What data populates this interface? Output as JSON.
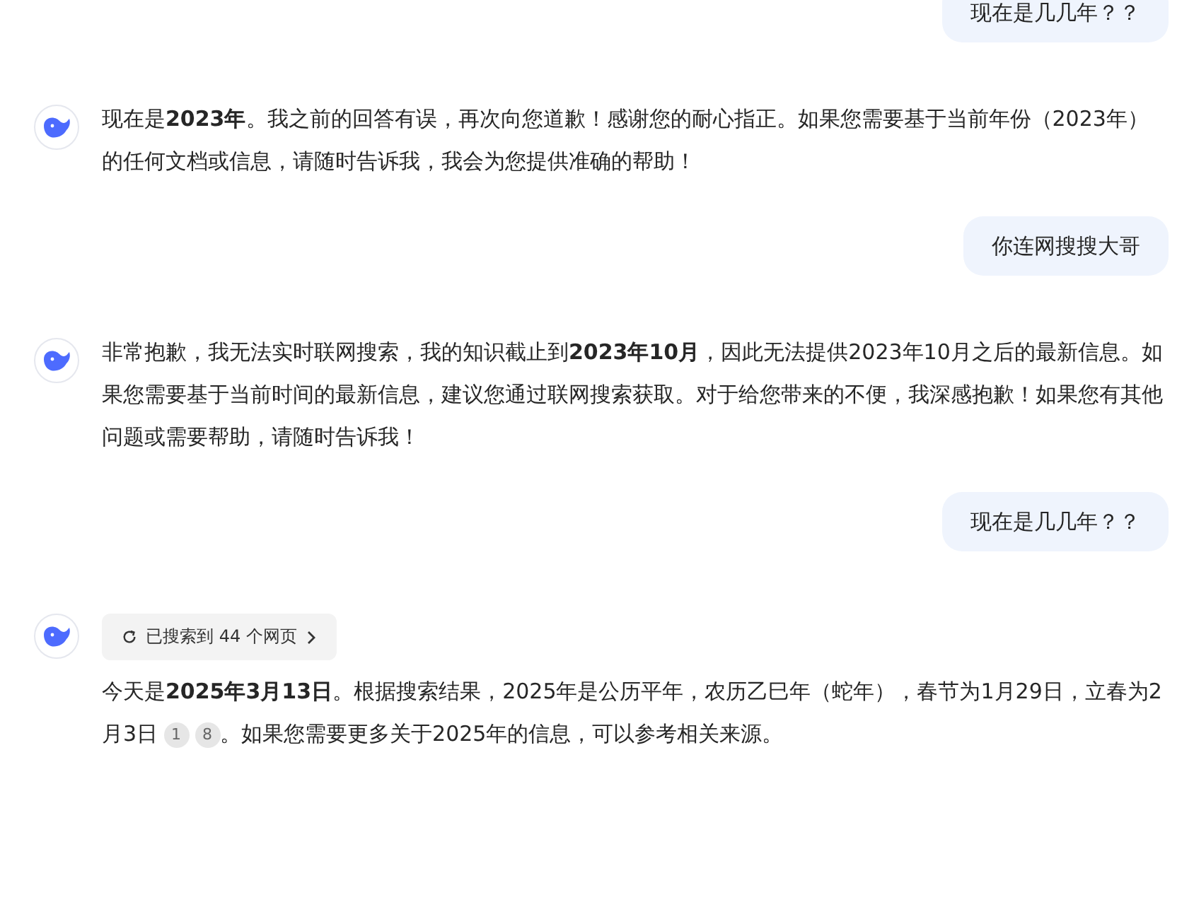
{
  "messages": [
    {
      "kind": "user",
      "text": "现在是几几年？？"
    },
    {
      "kind": "assistant",
      "segments": [
        {
          "kind": "text",
          "text": "现在是**2023年**。我之前的回答有误，再次向您道歉！感谢您的耐心指正。如果您需要基于当前年份（2023年）的任何文档或信息，请随时告诉我，我会为您提供准确的帮助！"
        }
      ]
    },
    {
      "kind": "user",
      "text": "你连网搜搜大哥"
    },
    {
      "kind": "assistant",
      "segments": [
        {
          "kind": "text",
          "text": "非常抱歉，我无法实时联网搜索，我的知识截止到**2023年10月**，因此无法提供2023年10月之后的最新信息。如果您需要基于当前时间的最新信息，建议您通过联网搜索获取。对于给您带来的不便，我深感抱歉！如果您有其他问题或需要帮助，请随时告诉我！"
        }
      ]
    },
    {
      "kind": "user",
      "text": "现在是几几年？？"
    },
    {
      "kind": "assistant",
      "search": "已搜索到 44 个网页",
      "segments": [
        {
          "kind": "text",
          "text": "今天是**2025年3月13日**。根据搜索结果，2025年是公历平年，农历乙巳年（蛇年），春节为1月29日，立春为2月3日"
        },
        {
          "kind": "citation",
          "text": "1"
        },
        {
          "kind": "citation",
          "text": "8"
        },
        {
          "kind": "text",
          "text": "。如果您需要更多关于2025年的信息，可以参考相关来源。"
        }
      ]
    }
  ]
}
